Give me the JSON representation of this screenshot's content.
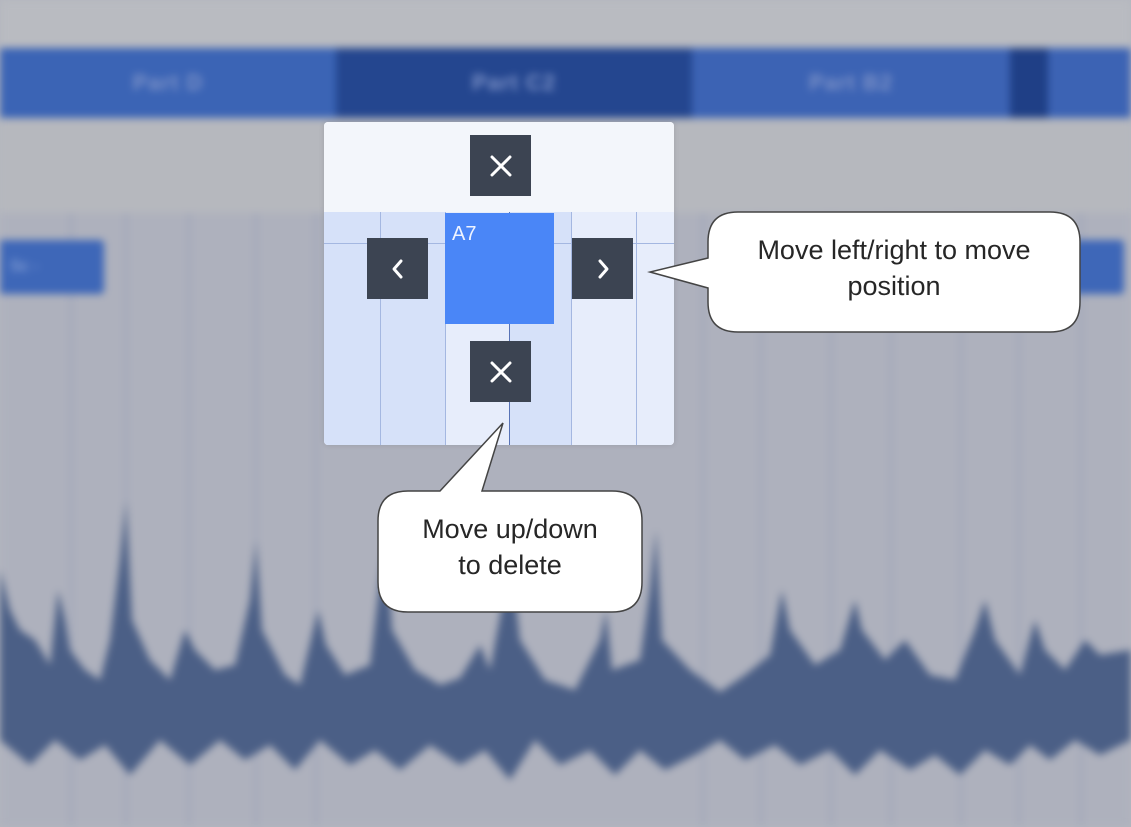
{
  "timeline": {
    "parts": [
      {
        "label": "Part D"
      },
      {
        "label": "Part C2"
      },
      {
        "label": "Part B2"
      }
    ],
    "left_chip_label": "Sc -"
  },
  "popup": {
    "chord_label": "A7",
    "icons": {
      "delete_up": "close-icon",
      "delete_down": "close-icon",
      "move_left": "chevron-left-icon",
      "move_right": "chevron-right-icon"
    }
  },
  "callouts": {
    "horizontal": {
      "line1": "Move left/right to move",
      "line2": "position"
    },
    "vertical": {
      "line1": "Move up/down",
      "line2": "to delete"
    }
  },
  "colors": {
    "accent": "#4a86f7",
    "button": "#3c4452",
    "part_bar": "#3e67b8",
    "part_bar_active": "#24468f"
  }
}
